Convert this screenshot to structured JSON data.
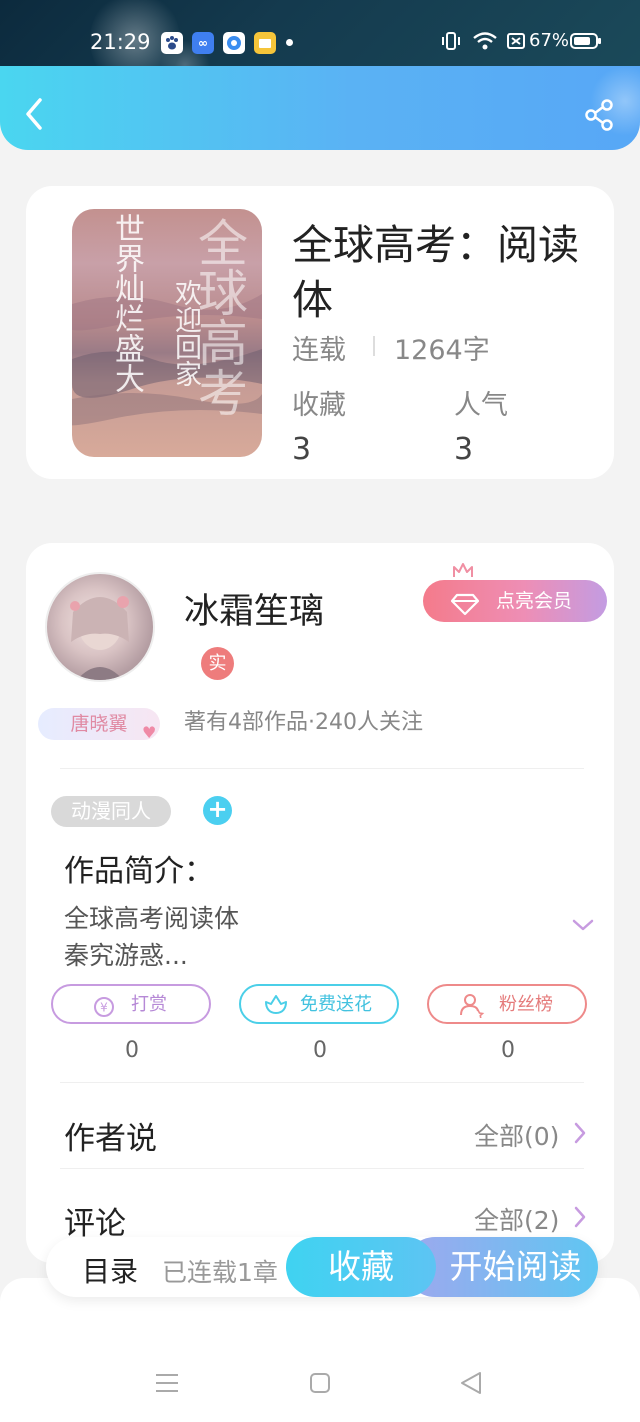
{
  "status_bar": {
    "time": "21:29",
    "app_icons": [
      "baidu-paw-icon",
      "infinity-app-icon",
      "blue-circle-app-icon",
      "yellow-folder-app-icon"
    ],
    "battery": "67%",
    "signal_icons": [
      "vibrate-icon",
      "wifi-icon",
      "battery-saver-icon",
      "battery-icon"
    ]
  },
  "header": {
    "back_icon": "back-arrow-icon",
    "share_icon": "share-icon"
  },
  "book": {
    "title": "全球高考：阅读体",
    "status": "连载",
    "word_count": "1264字",
    "favorites_label": "收藏",
    "favorites_value": "3",
    "popularity_label": "人气",
    "popularity_value": "3",
    "cover_text_left": "世界灿烂盛大",
    "cover_text_right": "欢迎回家",
    "cover_text_bg": "全球高考"
  },
  "author": {
    "name": "冰霜笙璃",
    "vip_label": "点亮会员",
    "real_badge": "实",
    "tag": "唐晓翼",
    "stats": "著有4部作品·240人关注"
  },
  "work": {
    "genre_tag": "动漫同人",
    "add_tag": "+",
    "intro_title": "作品简介：",
    "intro_line1": "全球高考阅读体",
    "intro_line2": "秦究游惑..."
  },
  "support": [
    {
      "label": "打赏",
      "count": "0",
      "icon": "yen-coin-icon",
      "color": "#c79be0"
    },
    {
      "label": "免费送花",
      "count": "0",
      "icon": "flower-icon",
      "color": "#4bcfe8"
    },
    {
      "label": "粉丝榜",
      "count": "0",
      "icon": "fan-person-icon",
      "color": "#ee8a8a"
    }
  ],
  "author_says": {
    "title": "作者说",
    "link": "全部(0)"
  },
  "comments": {
    "title": "评论",
    "link": "全部(2)"
  },
  "bottom_bar": {
    "toc_label": "目录",
    "serial_info": "已连载1章",
    "collect_label": "收藏",
    "read_label": "开始阅读"
  },
  "colors": {
    "header_start": "#4ad6f0",
    "header_end": "#57a7f6",
    "vip_gradient_start": "#f47b8b",
    "vip_gradient_end": "#c39ce2",
    "accent_purple": "#c79be0",
    "accent_cyan": "#4bcfe8",
    "accent_red": "#ee8a8a"
  }
}
